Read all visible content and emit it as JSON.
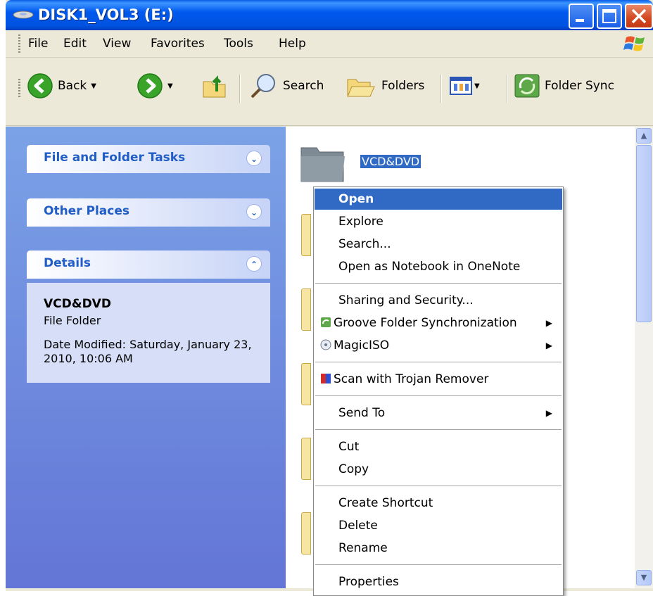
{
  "window": {
    "title": "DISK1_VOL3 (E:)"
  },
  "menubar": {
    "items": [
      "File",
      "Edit",
      "View",
      "Favorites",
      "Tools",
      "Help"
    ]
  },
  "toolbar": {
    "back_label": "Back",
    "search_label": "Search",
    "folders_label": "Folders",
    "folder_sync_label": "Folder Sync"
  },
  "tasks": {
    "file_folder_tasks": "File and Folder Tasks",
    "other_places": "Other Places",
    "details": "Details"
  },
  "details": {
    "name": "VCD&DVD",
    "type": "File Folder",
    "date_modified": "Date Modified: Saturday, January 23, 2010, 10:06 AM"
  },
  "content": {
    "selected_folder": "VCD&DVD"
  },
  "context_menu": {
    "open": "Open",
    "explore": "Explore",
    "search": "Search...",
    "open_onenote": "Open as Notebook in OneNote",
    "sharing": "Sharing and Security...",
    "groove": "Groove Folder Synchronization",
    "magiciso": "MagicISO",
    "trojan": "Scan with Trojan Remover",
    "send_to": "Send To",
    "cut": "Cut",
    "copy": "Copy",
    "create_shortcut": "Create Shortcut",
    "delete": "Delete",
    "rename": "Rename",
    "properties": "Properties"
  },
  "colors": {
    "title_blue": "#0058ee",
    "selection": "#316ac5",
    "task_pane": "#7ba2e7",
    "task_title": "#215dc6"
  }
}
